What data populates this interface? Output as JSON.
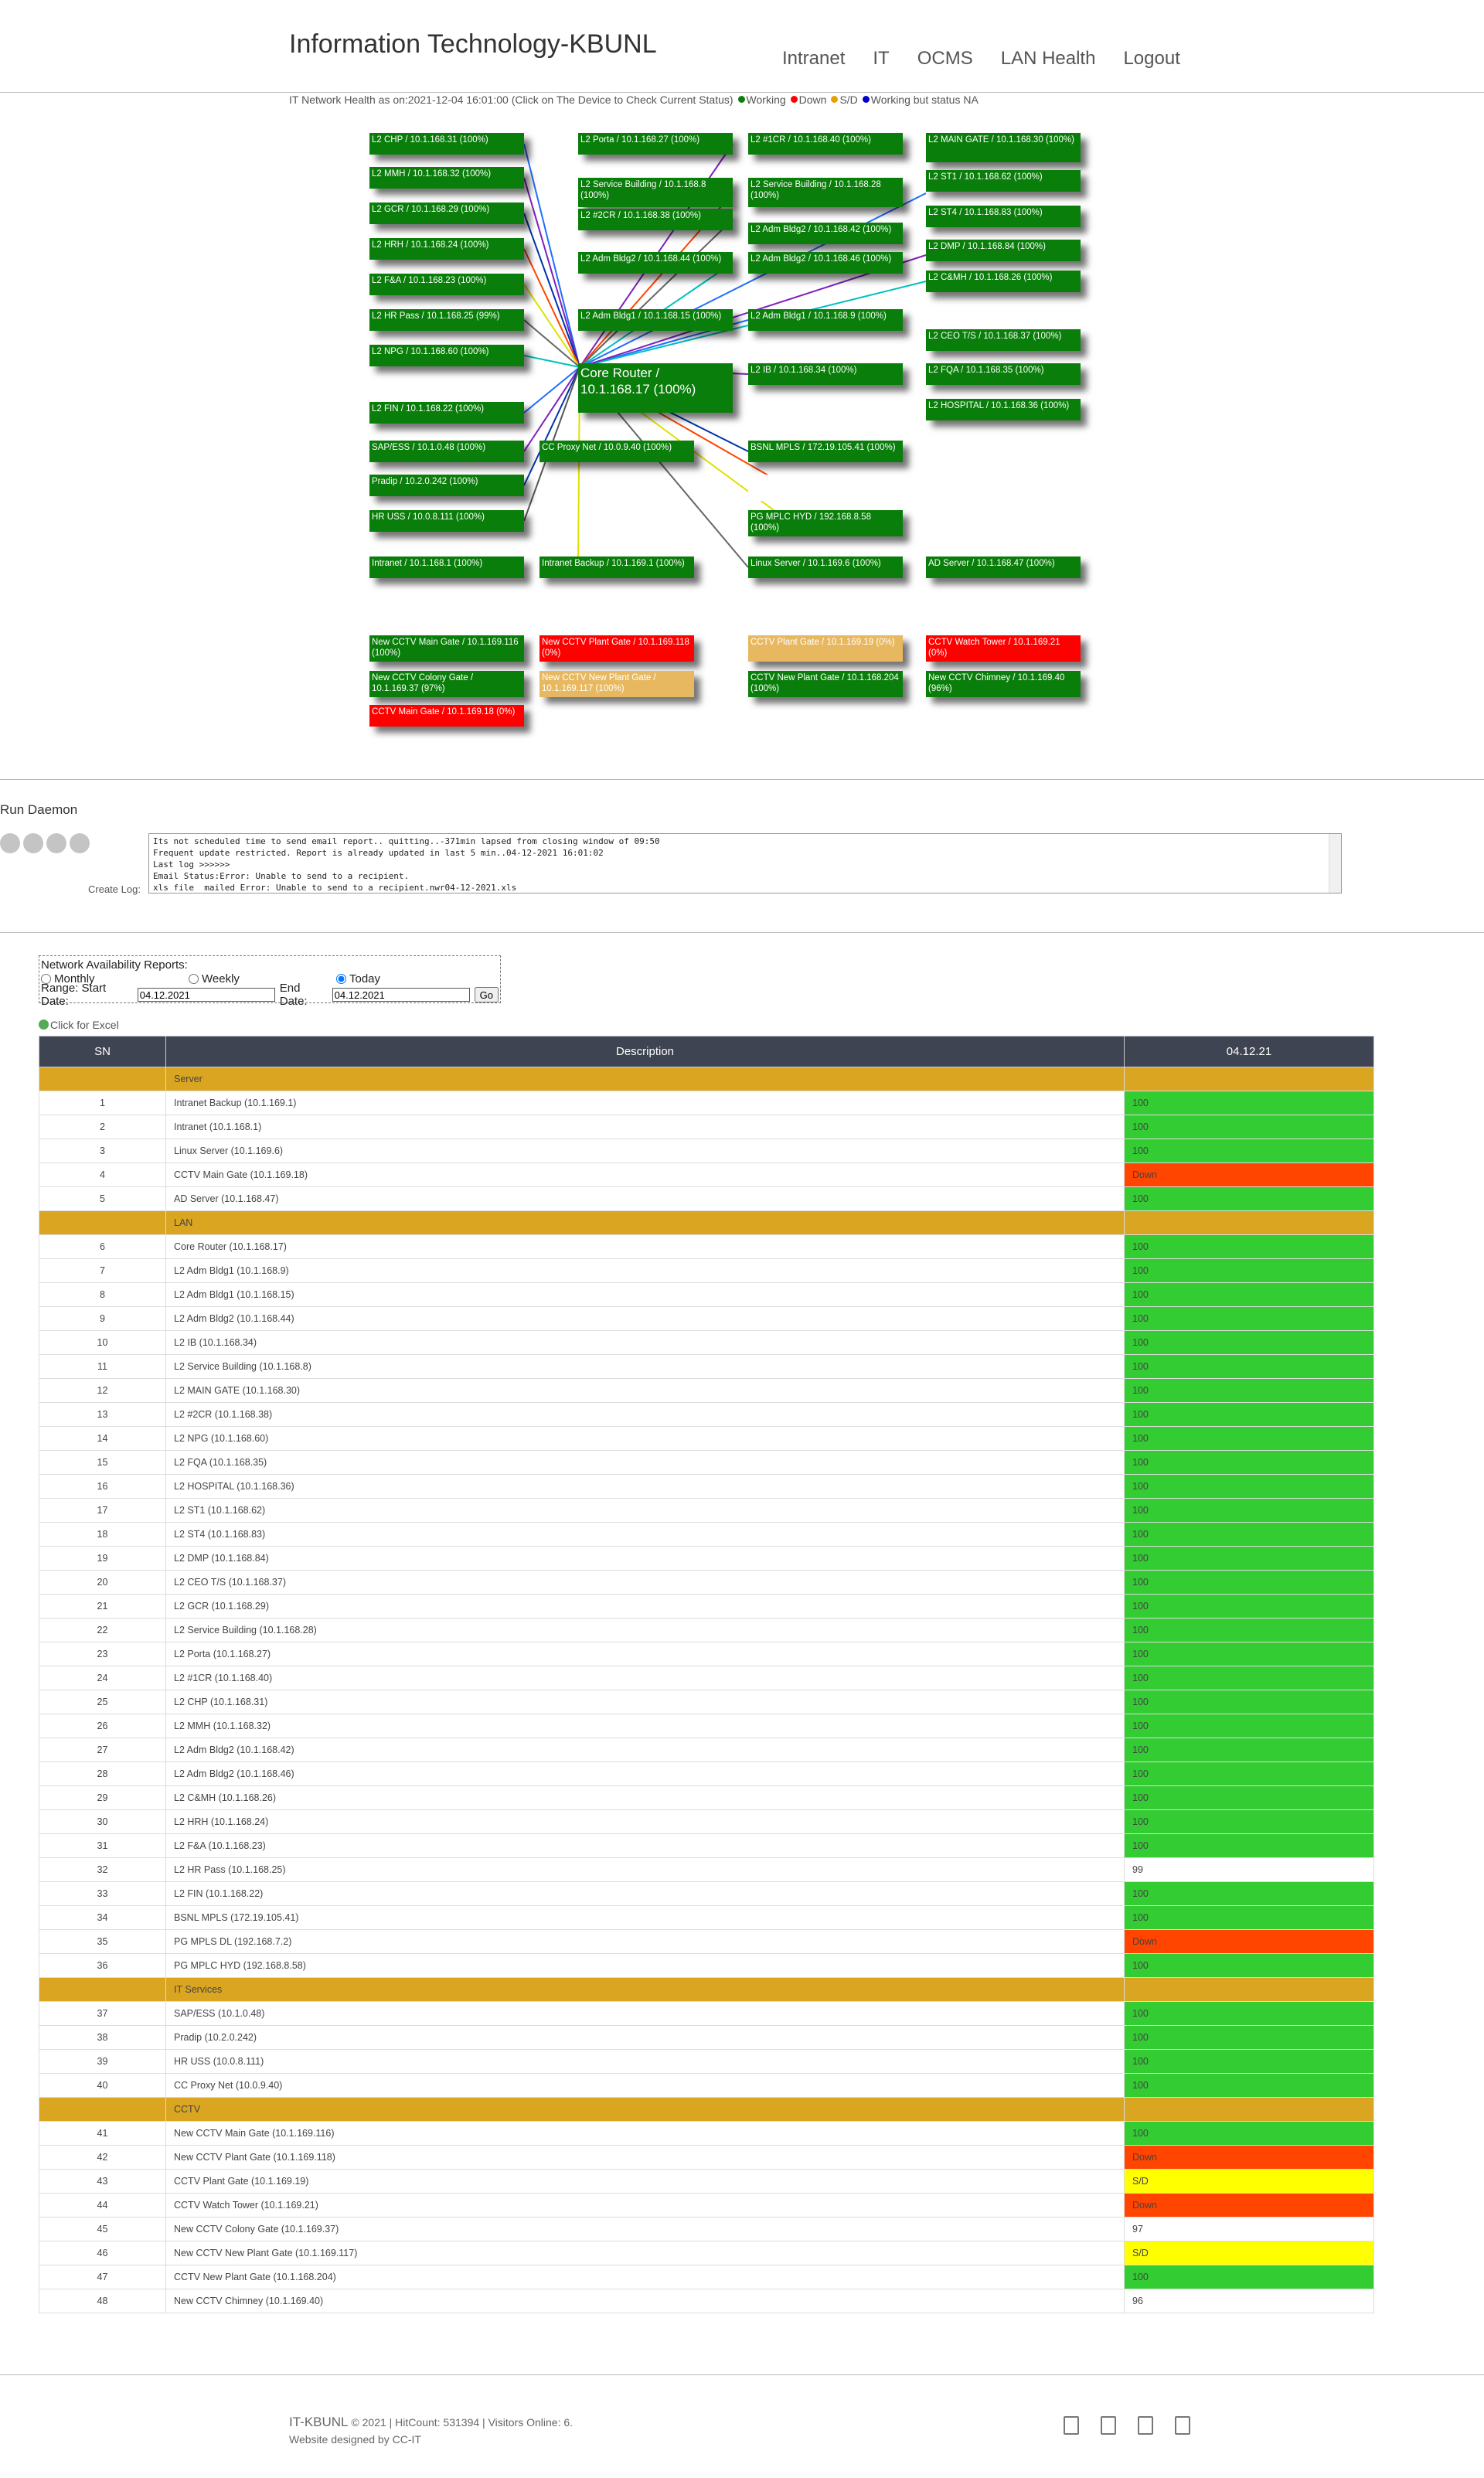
{
  "header": {
    "brand": "Information Technology-KBUNL",
    "nav": [
      "Intranet",
      "IT",
      "OCMS",
      "LAN Health",
      "Logout"
    ]
  },
  "health": {
    "caption": "IT Network Health as on:2021-12-04 16:01:00 (Click on The Device to Check Current Status)",
    "legend": [
      {
        "label": "Working",
        "color": "#0a7e0a"
      },
      {
        "label": "Down",
        "color": "#ff0000"
      },
      {
        "label": "S/D",
        "color": "#e8a000"
      },
      {
        "label": "Working but status NA",
        "color": "#0000cc"
      }
    ]
  },
  "map": {
    "nodes": [
      {
        "label": "L2 CHP / 10.1.168.31 (100%)",
        "status": "up"
      },
      {
        "label": "L2 MMH / 10.1.168.32 (100%)",
        "status": "up"
      },
      {
        "label": "L2 GCR / 10.1.168.29 (100%)",
        "status": "up"
      },
      {
        "label": "L2 HRH / 10.1.168.24 (100%)",
        "status": "up"
      },
      {
        "label": "L2 F&A / 10.1.168.23 (100%)",
        "status": "up"
      },
      {
        "label": "L2 HR Pass / 10.1.168.25 (99%)",
        "status": "up"
      },
      {
        "label": "L2 NPG / 10.1.168.60 (100%)",
        "status": "up"
      },
      {
        "label": "L2 FIN / 10.1.168.22 (100%)",
        "status": "up"
      },
      {
        "label": "SAP/ESS / 10.1.0.48 (100%)",
        "status": "up"
      },
      {
        "label": "Pradip / 10.2.0.242 (100%)",
        "status": "up"
      },
      {
        "label": "HR USS / 10.0.8.111 (100%)",
        "status": "up"
      },
      {
        "label": "Intranet / 10.1.168.1 (100%)",
        "status": "up"
      },
      {
        "label": "L2 Porta / 10.1.168.27 (100%)",
        "status": "up"
      },
      {
        "label": "L2 Service Building / 10.1.168.8 (100%)",
        "status": "up"
      },
      {
        "label": "L2 #2CR / 10.1.168.38 (100%)",
        "status": "up"
      },
      {
        "label": "L2 Adm Bldg2 / 10.1.168.44 (100%)",
        "status": "up"
      },
      {
        "label": "L2 Adm Bldg1 / 10.1.168.15 (100%)",
        "status": "up"
      },
      {
        "label": "Core Router / 10.1.168.17 (100%)",
        "status": "up"
      },
      {
        "label": "CC Proxy Net / 10.0.9.40 (100%)",
        "status": "up"
      },
      {
        "label": "Intranet Backup / 10.1.169.1 (100%)",
        "status": "up"
      },
      {
        "label": "L2 #1CR / 10.1.168.40 (100%)",
        "status": "up"
      },
      {
        "label": "L2 Service Building / 10.1.168.28 (100%)",
        "status": "up"
      },
      {
        "label": "L2 Adm Bldg2 / 10.1.168.42 (100%)",
        "status": "up"
      },
      {
        "label": "L2 Adm Bldg2 / 10.1.168.46 (100%)",
        "status": "up"
      },
      {
        "label": "L2 Adm Bldg1 / 10.1.168.9 (100%)",
        "status": "up"
      },
      {
        "label": "L2 IB / 10.1.168.34 (100%)",
        "status": "up"
      },
      {
        "label": "BSNL MPLS / 172.19.105.41 (100%)",
        "status": "up"
      },
      {
        "label": "",
        "status": "blank"
      },
      {
        "label": "PG MPLC HYD / 192.168.8.58 (100%)",
        "status": "up"
      },
      {
        "label": "Linux Server / 10.1.169.6 (100%)",
        "status": "up"
      },
      {
        "label": "L2 MAIN GATE / 10.1.168.30 (100%)",
        "status": "up"
      },
      {
        "label": "L2 ST1 / 10.1.168.62 (100%)",
        "status": "up"
      },
      {
        "label": "L2 ST4 / 10.1.168.83 (100%)",
        "status": "up"
      },
      {
        "label": "L2 DMP / 10.1.168.84 (100%)",
        "status": "up"
      },
      {
        "label": "L2 C&MH / 10.1.168.26 (100%)",
        "status": "up"
      },
      {
        "label": "L2 CEO T/S / 10.1.168.37 (100%)",
        "status": "up"
      },
      {
        "label": "L2 FQA / 10.1.168.35 (100%)",
        "status": "up"
      },
      {
        "label": "L2 HOSPITAL / 10.1.168.36 (100%)",
        "status": "up"
      },
      {
        "label": "AD Server / 10.1.168.47 (100%)",
        "status": "up"
      },
      {
        "label": "New CCTV Main Gate / 10.1.169.116 (100%)",
        "status": "up"
      },
      {
        "label": "New CCTV Colony Gate / 10.1.169.37 (97%)",
        "status": "up"
      },
      {
        "label": "CCTV Main Gate / 10.1.169.18 (0%)",
        "status": "down"
      },
      {
        "label": "New CCTV Plant Gate / 10.1.169.118 (0%)",
        "status": "down"
      },
      {
        "label": "New CCTV New Plant Gate / 10.1.169.117 (100%)",
        "status": "sd"
      },
      {
        "label": "CCTV Plant Gate / 10.1.169.19 (0%)",
        "status": "sd"
      },
      {
        "label": "CCTV New Plant Gate / 10.1.168.204 (100%)",
        "status": "up"
      },
      {
        "label": "CCTV Watch Tower / 10.1.169.21 (0%)",
        "status": "down"
      },
      {
        "label": "New CCTV Chimney / 10.1.169.40 (96%)",
        "status": "up"
      }
    ]
  },
  "daemon": {
    "title": "Run Daemon",
    "log": "Its not scheduled time to send email report.. quitting..-371min lapsed from closing window of 09:50\nFrequent update restricted. Report is already updated in last 5 min..04-12-2021 16:01:02\nLast log >>>>>>\nEmail Status:Error: Unable to send to a recipient.\nxls file  mailed Error: Unable to send to a recipient.nwr04-12-2021.xls",
    "create_log": "Create Log:"
  },
  "reports": {
    "title": "Network Availability Reports:",
    "options": [
      "Monthly",
      "Weekly",
      "Today"
    ],
    "selected": "Today",
    "range_label": "Range: Start Date:",
    "start_date": "04.12.2021",
    "end_label": "End Date:",
    "end_date": "04.12.2021",
    "go": "Go"
  },
  "excel": "Click for Excel",
  "table": {
    "headers": [
      "SN",
      "Description",
      "04.12.21"
    ],
    "rows": [
      {
        "group": "Server"
      },
      {
        "sn": "1",
        "desc": "Intranet Backup (10.1.169.1)",
        "val": "100"
      },
      {
        "sn": "2",
        "desc": "Intranet (10.1.168.1)",
        "val": "100"
      },
      {
        "sn": "3",
        "desc": "Linux Server (10.1.169.6)",
        "val": "100"
      },
      {
        "sn": "4",
        "desc": "CCTV Main Gate (10.1.169.18)",
        "val": "Down"
      },
      {
        "sn": "5",
        "desc": "AD Server (10.1.168.47)",
        "val": "100"
      },
      {
        "group": "LAN"
      },
      {
        "sn": "6",
        "desc": "Core Router (10.1.168.17)",
        "val": "100"
      },
      {
        "sn": "7",
        "desc": "L2 Adm Bldg1 (10.1.168.9)",
        "val": "100"
      },
      {
        "sn": "8",
        "desc": "L2 Adm Bldg1 (10.1.168.15)",
        "val": "100"
      },
      {
        "sn": "9",
        "desc": "L2 Adm Bldg2 (10.1.168.44)",
        "val": "100"
      },
      {
        "sn": "10",
        "desc": "L2 IB (10.1.168.34)",
        "val": "100"
      },
      {
        "sn": "11",
        "desc": "L2 Service Building (10.1.168.8)",
        "val": "100"
      },
      {
        "sn": "12",
        "desc": "L2 MAIN GATE (10.1.168.30)",
        "val": "100"
      },
      {
        "sn": "13",
        "desc": "L2 #2CR (10.1.168.38)",
        "val": "100"
      },
      {
        "sn": "14",
        "desc": "L2 NPG (10.1.168.60)",
        "val": "100"
      },
      {
        "sn": "15",
        "desc": "L2 FQA (10.1.168.35)",
        "val": "100"
      },
      {
        "sn": "16",
        "desc": "L2 HOSPITAL (10.1.168.36)",
        "val": "100"
      },
      {
        "sn": "17",
        "desc": "L2 ST1 (10.1.168.62)",
        "val": "100"
      },
      {
        "sn": "18",
        "desc": "L2 ST4 (10.1.168.83)",
        "val": "100"
      },
      {
        "sn": "19",
        "desc": "L2 DMP (10.1.168.84)",
        "val": "100"
      },
      {
        "sn": "20",
        "desc": "L2 CEO T/S (10.1.168.37)",
        "val": "100"
      },
      {
        "sn": "21",
        "desc": "L2 GCR (10.1.168.29)",
        "val": "100"
      },
      {
        "sn": "22",
        "desc": "L2 Service Building (10.1.168.28)",
        "val": "100"
      },
      {
        "sn": "23",
        "desc": "L2 Porta (10.1.168.27)",
        "val": "100"
      },
      {
        "sn": "24",
        "desc": "L2 #1CR (10.1.168.40)",
        "val": "100"
      },
      {
        "sn": "25",
        "desc": "L2 CHP (10.1.168.31)",
        "val": "100"
      },
      {
        "sn": "26",
        "desc": "L2 MMH (10.1.168.32)",
        "val": "100"
      },
      {
        "sn": "27",
        "desc": "L2 Adm Bldg2 (10.1.168.42)",
        "val": "100"
      },
      {
        "sn": "28",
        "desc": "L2 Adm Bldg2 (10.1.168.46)",
        "val": "100"
      },
      {
        "sn": "29",
        "desc": "L2 C&MH (10.1.168.26)",
        "val": "100"
      },
      {
        "sn": "30",
        "desc": "L2 HRH (10.1.168.24)",
        "val": "100"
      },
      {
        "sn": "31",
        "desc": "L2 F&A (10.1.168.23)",
        "val": "100"
      },
      {
        "sn": "32",
        "desc": "L2 HR Pass (10.1.168.25)",
        "val": "99"
      },
      {
        "sn": "33",
        "desc": "L2 FIN (10.1.168.22)",
        "val": "100"
      },
      {
        "sn": "34",
        "desc": "BSNL MPLS (172.19.105.41)",
        "val": "100"
      },
      {
        "sn": "35",
        "desc": "PG MPLS DL (192.168.7.2)",
        "val": "Down"
      },
      {
        "sn": "36",
        "desc": "PG MPLC HYD (192.168.8.58)",
        "val": "100"
      },
      {
        "group": "IT Services"
      },
      {
        "sn": "37",
        "desc": "SAP/ESS (10.1.0.48)",
        "val": "100"
      },
      {
        "sn": "38",
        "desc": "Pradip (10.2.0.242)",
        "val": "100"
      },
      {
        "sn": "39",
        "desc": "HR USS (10.0.8.111)",
        "val": "100"
      },
      {
        "sn": "40",
        "desc": "CC Proxy Net (10.0.9.40)",
        "val": "100"
      },
      {
        "group": "CCTV"
      },
      {
        "sn": "41",
        "desc": "New CCTV Main Gate (10.1.169.116)",
        "val": "100"
      },
      {
        "sn": "42",
        "desc": "New CCTV Plant Gate (10.1.169.118)",
        "val": "Down"
      },
      {
        "sn": "43",
        "desc": "CCTV Plant Gate (10.1.169.19)",
        "val": "S/D"
      },
      {
        "sn": "44",
        "desc": "CCTV Watch Tower (10.1.169.21)",
        "val": "Down"
      },
      {
        "sn": "45",
        "desc": "New CCTV Colony Gate (10.1.169.37)",
        "val": "97"
      },
      {
        "sn": "46",
        "desc": "New CCTV New Plant Gate (10.1.169.117)",
        "val": "S/D"
      },
      {
        "sn": "47",
        "desc": "CCTV New Plant Gate (10.1.168.204)",
        "val": "100"
      },
      {
        "sn": "48",
        "desc": "New CCTV Chimney (10.1.169.40)",
        "val": "96"
      }
    ]
  },
  "footer": {
    "brand": "IT-KBUNL",
    "meta": " © 2021 | HitCount: 531394 | Visitors Online: 6.",
    "designer": "Website designed by CC-IT"
  }
}
